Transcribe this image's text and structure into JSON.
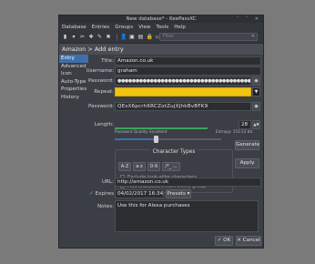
{
  "window": {
    "title": "New database* - KeePassXC",
    "controls": "ˇ ˆ ✕"
  },
  "menu": [
    "Database",
    "Entries",
    "Groups",
    "View",
    "Tools",
    "Help"
  ],
  "toolbar": {
    "search_placeholder": "Filter",
    "clear": "✕"
  },
  "header": "Amazon > Add entry",
  "sidebar": [
    "Entry",
    "Advanced",
    "Icon",
    "Auto-Type",
    "Properties",
    "History"
  ],
  "form": {
    "title_label": "Title:",
    "title": "Amazon.co.uk",
    "username_label": "Username:",
    "username": "graham",
    "password_label": "Password:",
    "password": "●●●●●●●●●●●●●●●●●●●●●●●●●●●●●●●●●●●●●●●●●●●●●●●●●",
    "repeat_label": "Repeat:",
    "repeat": "",
    "gen_password_label": "Password:",
    "gen_password": "QEsX6pcrh6RCZotZujXJhkBvBFK9",
    "quality": "Password Quality: Excellent",
    "quality_fraction": 1.0,
    "entropy": "Entropy: 153.53 bit",
    "length_label": "Length:",
    "length": "28",
    "char_types_title": "Character Types",
    "char_buttons": [
      "A-Z",
      "a-z",
      "0-9",
      "/*_ ..."
    ],
    "exclude_label": "Exclude look-alike characters",
    "pick_label": "Pick characters from every group",
    "generate_button": "Generate",
    "apply_button": "Apply",
    "url_label": "URL:",
    "url": "http://amazon.co.uk",
    "expires_label": "Expires",
    "expires": "04/02/2017 16:34",
    "presets_button": "Presets",
    "notes_label": "Notes:",
    "notes": "Use this for Alexa purchases"
  },
  "footer": {
    "ok": "✓ OK",
    "cancel": "✕ Cancel"
  }
}
